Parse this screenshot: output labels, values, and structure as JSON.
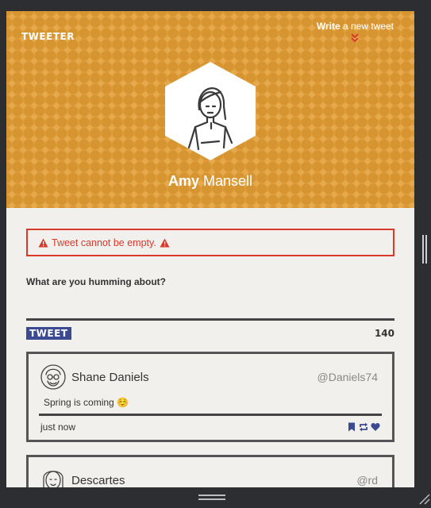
{
  "header": {
    "logo": "TWEETER",
    "write_bold": "Write",
    "write_rest": " a new tweet",
    "profile_first": "Amy",
    "profile_last": " Mansell"
  },
  "compose": {
    "error": "Tweet cannot be empty.",
    "prompt": "What are you humming about?",
    "textarea_value": "",
    "tweet_button": "TWEET",
    "char_count": "140"
  },
  "tweets": [
    {
      "name": "Shane Daniels",
      "handle": "@Daniels74",
      "text": "Spring is coming ☺️",
      "time": "just now"
    },
    {
      "name": "Descartes",
      "handle": "@rd"
    }
  ],
  "colors": {
    "header_bg": "#e3a03a",
    "error": "#d8392b",
    "accent": "#3b4a91"
  },
  "icons": [
    "chevron-double-down-icon",
    "warning-icon",
    "bookmark-icon",
    "retweet-icon",
    "heart-icon"
  ]
}
